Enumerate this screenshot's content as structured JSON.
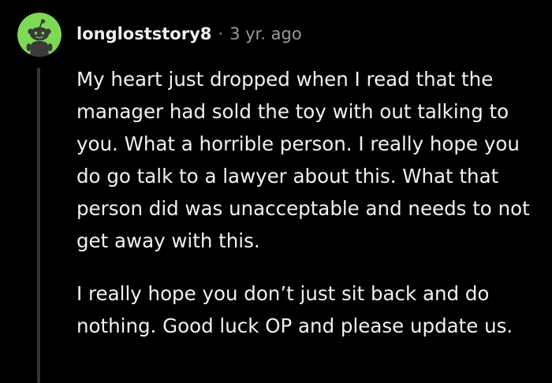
{
  "comment": {
    "username": "longloststory8",
    "separator": "·",
    "timestamp": "3 yr. ago",
    "avatar_icon": "snoo-avatar-icon",
    "paragraphs": [
      "My heart just dropped when I read that the manager had sold the toy with out talking to you. What a horrible person. I really hope you do go talk to a lawyer about this. What that person did was unacceptable and needs to not get away with this.",
      "I really hope you don’t just sit back and do nothing. Good luck OP and please update us."
    ]
  },
  "colors": {
    "background": "#000000",
    "text": "#f2f2f2",
    "meta": "#9a9a9a",
    "avatar_green": "#7ed957",
    "thread_line": "#343536"
  }
}
